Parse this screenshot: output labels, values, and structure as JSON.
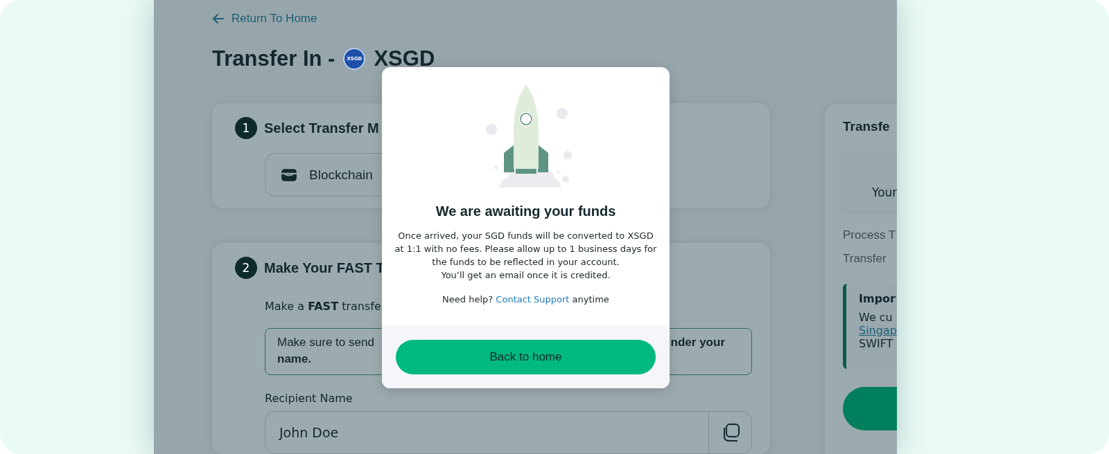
{
  "back_link": "Return To Home",
  "page_title": {
    "text": "Transfer In -",
    "token": "XSGD",
    "token_badge": "XSGD"
  },
  "step_1": {
    "number": "1",
    "title": "Select Transfer M",
    "option": "Blockchain"
  },
  "step_2": {
    "number": "2",
    "title": "Make Your FAST T",
    "instruction": "Make a **FAST** transfe",
    "notice": {
      "line_1_start": "Make sure to send",
      "line_1_end": "nder your",
      "line_2": "name."
    },
    "recipient": {
      "label": "Recipient Name",
      "value": "John Doe"
    }
  },
  "summary": {
    "title": "Transfe",
    "box_text": "Your",
    "rows": [
      "Process T",
      "Transfer"
    ],
    "important": {
      "title": "Impor",
      "line_1": "We cu",
      "link": "Singap",
      "line_3": "SWIFT"
    }
  },
  "modal": {
    "title": "We are awaiting your funds",
    "body": [
      "Once arrived, your SGD funds will be converted to XSGD at 1:1 with no fees. Please allow up to 1 business days for the funds to be reflected in your account.",
      "You’ll get an email once it is credited."
    ],
    "help": {
      "before": "Need help? ",
      "link": "Contact Support",
      "after": " anytime"
    },
    "button": "Back to home"
  }
}
